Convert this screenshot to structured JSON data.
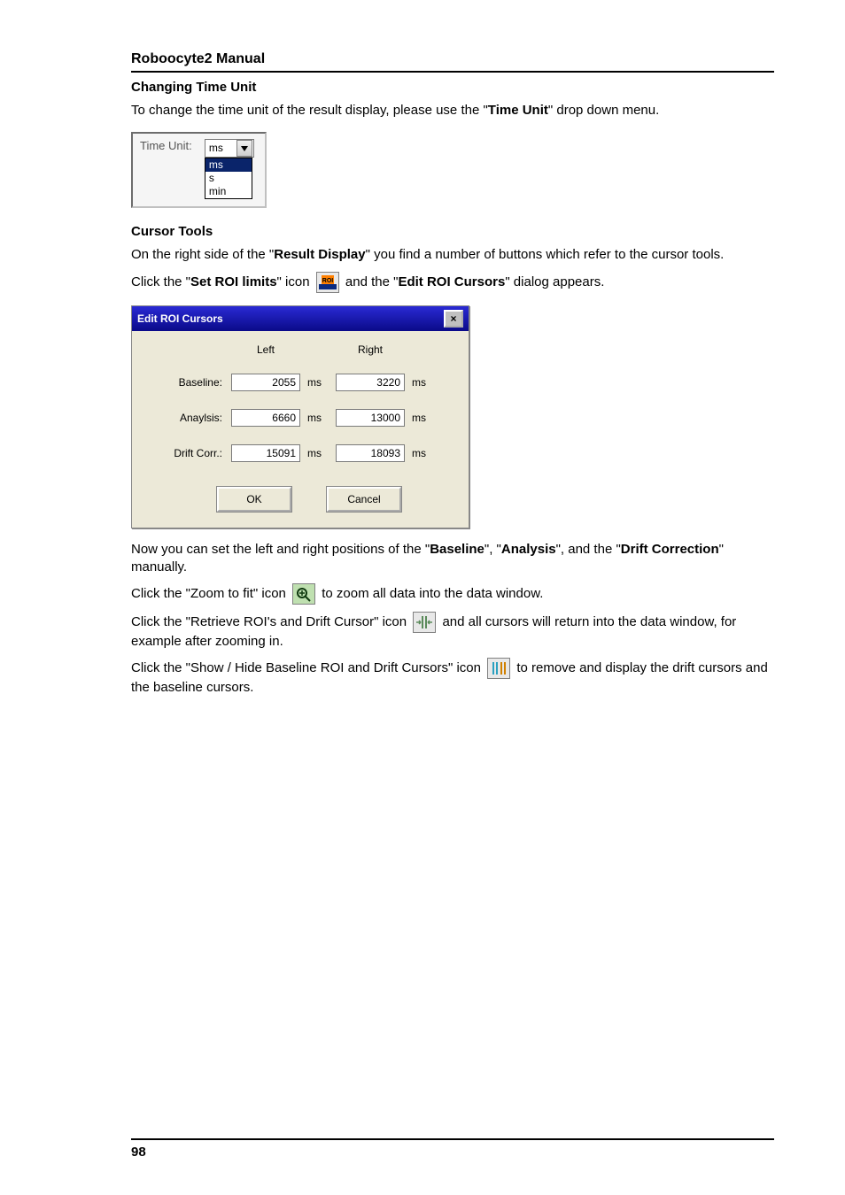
{
  "doc": {
    "title": "Roboocyte2  Manual"
  },
  "sections": {
    "changing_time_unit": "Changing Time Unit",
    "cursor_tools": "Cursor Tools"
  },
  "paragraphs": {
    "p1_a": "To change the time unit of the result display, please use the \"",
    "p1_b": "Time Unit",
    "p1_c": "\" drop down menu.",
    "p2": "On the right side of the \"",
    "p2_b": "Result Display",
    "p2_c": "\" you find a number of buttons which refer to the cursor tools.",
    "p3_a": "Click the \"",
    "p3_b": "Set ROI limits",
    "p3_c": "\" icon ",
    "p3_d": " and the \"",
    "p3_e": "Edit ROI Cursors",
    "p3_f": "\" dialog appears.",
    "p4_a": "Now you can set the left and right positions of the \"",
    "p4_b1": "Baseline",
    "p4_b2": "\", \"",
    "p4_b3": "Analysis",
    "p4_b4": "\", and the \"",
    "p4_b5": "Drift Correction",
    "p4_b6": "\" manually.",
    "p5_a": "Click the \"Zoom to fit\" icon ",
    "p5_b": " to zoom all data into the data window.",
    "p6_a": "Click the \"Retrieve ROI's and Drift Cursor\" icon ",
    "p6_b": " and all cursors will return into the data window, for example after zooming in.",
    "p7_a": "Click the \"Show / Hide Baseline ROI and Drift Cursors\" icon ",
    "p7_b": " to remove and display the drift cursors and the baseline cursors."
  },
  "time_unit": {
    "label": "Time Unit:",
    "selected": "ms",
    "options": [
      "ms",
      "s",
      "min"
    ]
  },
  "dialog": {
    "title": "Edit ROI Cursors",
    "head_left": "Left",
    "head_right": "Right",
    "rows": [
      {
        "label": "Baseline:",
        "left": "2055",
        "right": "3220"
      },
      {
        "label": "Anaylsis:",
        "left": "6660",
        "right": "13000"
      },
      {
        "label": "Drift Corr.:",
        "left": "15091",
        "right": "18093"
      }
    ],
    "unit": "ms",
    "ok": "OK",
    "cancel": "Cancel"
  },
  "page_number": "98"
}
